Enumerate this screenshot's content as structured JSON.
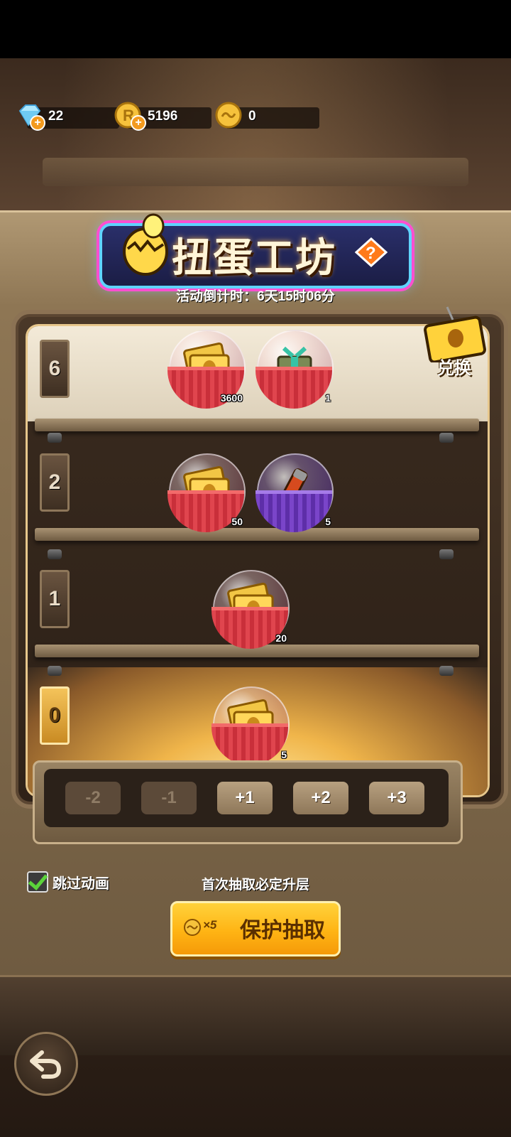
{
  "currency": [
    {
      "icon": "diamond-icon",
      "value": "22",
      "has_plus": true
    },
    {
      "icon": "r-coin-icon",
      "value": "5196",
      "has_plus": true
    },
    {
      "icon": "gacha-coin-icon",
      "value": "0",
      "has_plus": false
    }
  ],
  "title": "扭蛋工坊",
  "countdown": "活动倒计时：6天15时06分",
  "exchange": {
    "label": "兑换"
  },
  "floors": [
    {
      "label": "6",
      "active": false,
      "prizes": [
        {
          "item": "ticket-icon",
          "qty": "3600",
          "capsule": "red"
        },
        {
          "item": "mystery-gift-icon",
          "qty": "1",
          "capsule": "red"
        }
      ]
    },
    {
      "label": "2",
      "active": false,
      "prizes": [
        {
          "item": "ticket-icon",
          "qty": "50",
          "capsule": "red"
        },
        {
          "item": "tube-item-icon",
          "qty": "5",
          "capsule": "purple"
        }
      ]
    },
    {
      "label": "1",
      "active": false,
      "prizes": [
        {
          "item": "ticket-icon",
          "qty": "20",
          "capsule": "red"
        }
      ]
    },
    {
      "label": "0",
      "active": true,
      "prizes": [
        {
          "item": "ticket-icon",
          "qty": "5",
          "capsule": "red"
        }
      ]
    }
  ],
  "steps": [
    {
      "label": "-2",
      "enabled": false
    },
    {
      "label": "-1",
      "enabled": false
    },
    {
      "label": "+1",
      "enabled": true
    },
    {
      "label": "+2",
      "enabled": true
    },
    {
      "label": "+3",
      "enabled": true
    }
  ],
  "skip_animation": {
    "label": "跳过动画",
    "checked": true
  },
  "guarantee_text": "首次抽取必定升层",
  "draw_button": {
    "cost": "×5",
    "label": "保护抽取"
  },
  "colors": {
    "accent": "#ffb414",
    "banner_border": "#5fd3ff",
    "banner_glow": "#ff4fd0"
  }
}
